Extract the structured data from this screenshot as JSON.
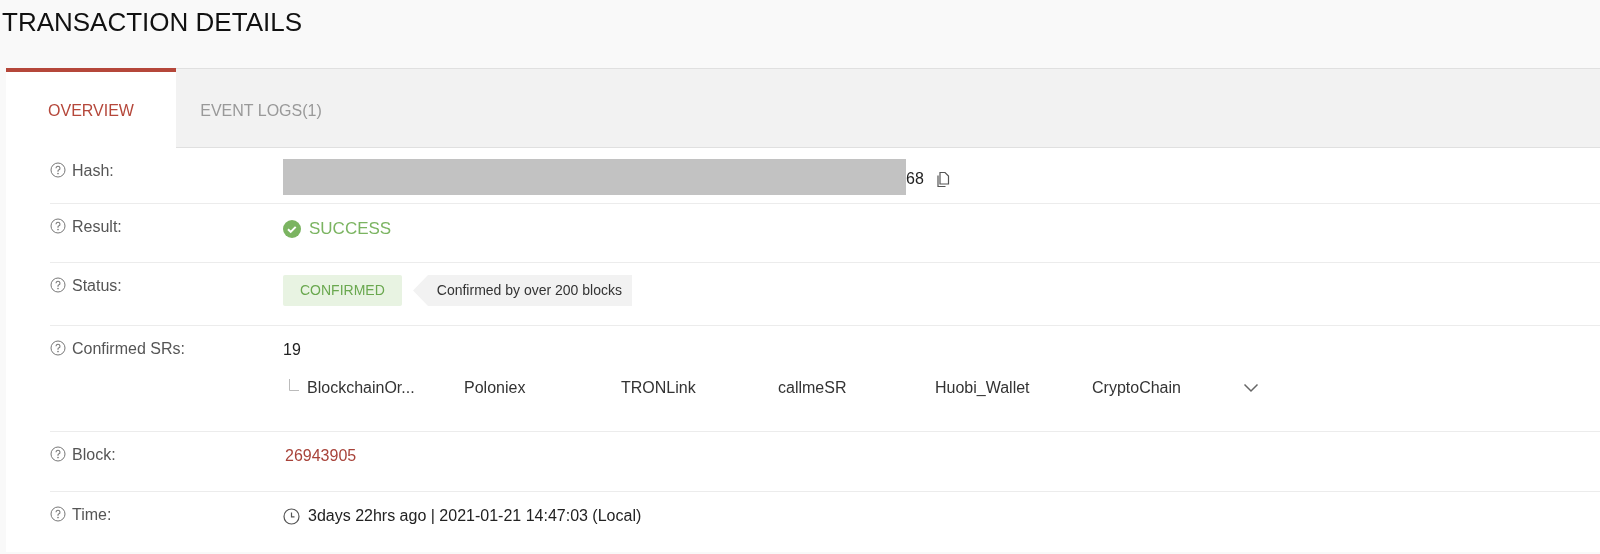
{
  "page_title": "TRANSACTION DETAILS",
  "tabs": [
    {
      "label": "OVERVIEW",
      "selected": true
    },
    {
      "label": "EVENT LOGS(1)",
      "selected": false
    }
  ],
  "fields": [
    {
      "kind": "hash",
      "label": "Hash:",
      "value": "68",
      "redacted": true
    },
    {
      "kind": "result",
      "label": "Result:",
      "value": "SUCCESS"
    },
    {
      "kind": "status",
      "label": "Status:",
      "value": "CONFIRMED",
      "note": "Confirmed by over 200 blocks"
    },
    {
      "kind": "srs",
      "label": "Confirmed SRs:",
      "value": "19",
      "items": [
        "BlockchainOr...",
        "Poloniex",
        "TRONLink",
        "callmeSR",
        "Huobi_Wallet",
        "CryptoChain"
      ],
      "expanded": false
    },
    {
      "kind": "link",
      "label": "Block:",
      "value": "26943905"
    },
    {
      "kind": "time",
      "label": "Time:",
      "value": "3days 22hrs ago | 2021-01-21 14:47:03 (Local)"
    }
  ]
}
